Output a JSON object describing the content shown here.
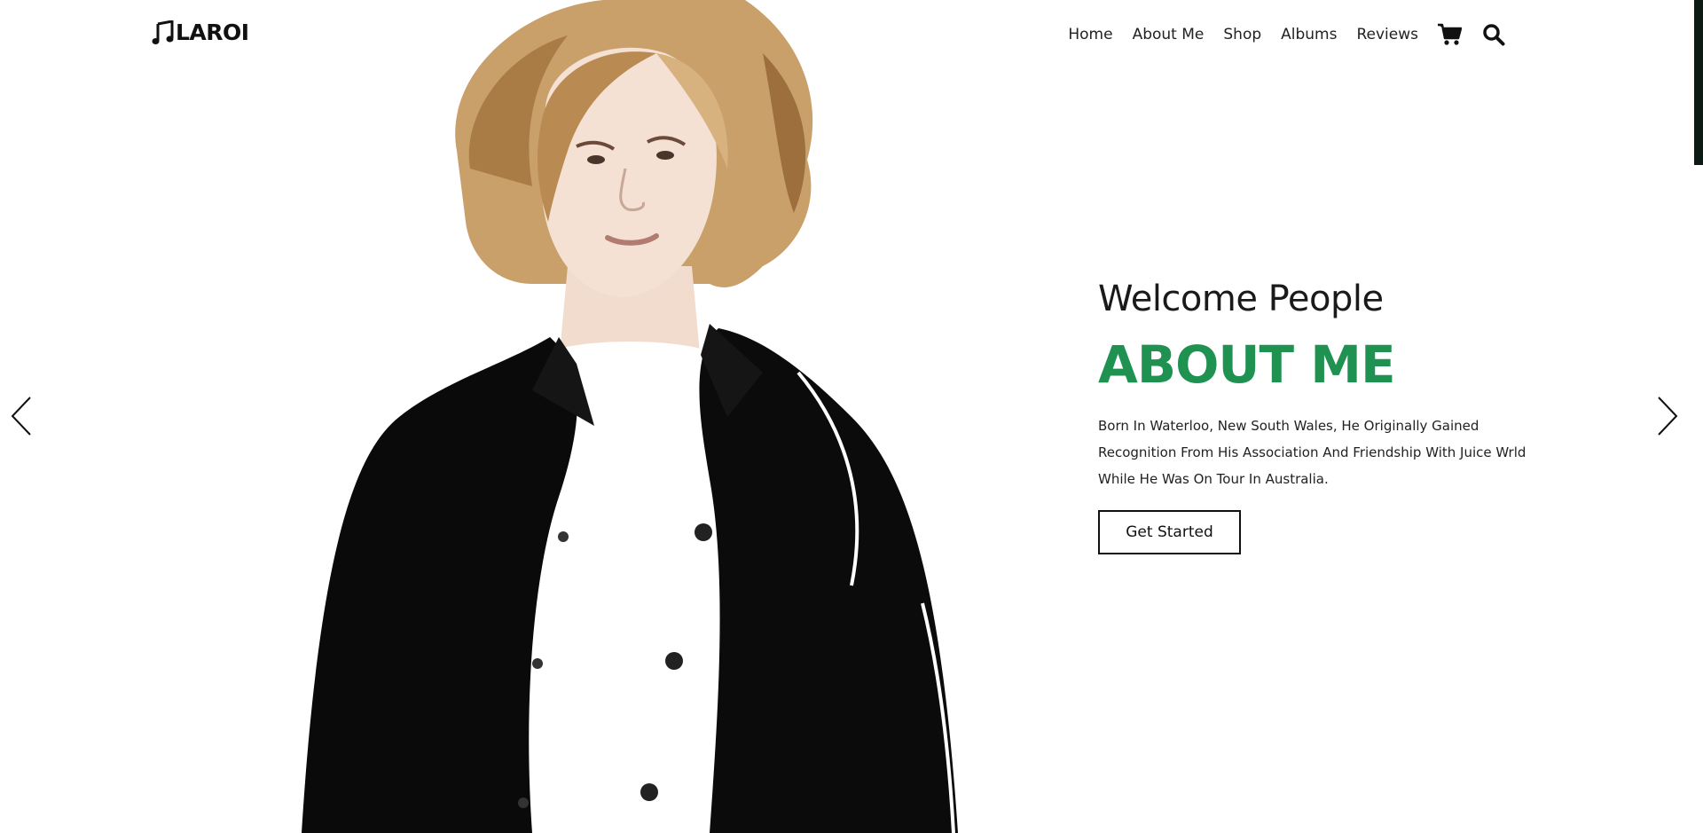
{
  "header": {
    "logo_text": "LAROI",
    "nav": [
      {
        "label": "Home"
      },
      {
        "label": "About Me"
      },
      {
        "label": "Shop"
      },
      {
        "label": "Albums"
      },
      {
        "label": "Reviews"
      }
    ],
    "icons": [
      "shopping-cart-icon",
      "search-icon"
    ]
  },
  "hero": {
    "subtitle": "Welcome People",
    "title": "ABOUT ME",
    "description": "Born In Waterloo, New South Wales, He Originally Gained Recognition From His Association And Friendship With Juice Wrld While He Was On Tour In Australia.",
    "button_label": "Get Started"
  },
  "colors": {
    "accent_green": "#1f9150",
    "text_dark": "#1a1a1a",
    "background": "#ffffff"
  }
}
